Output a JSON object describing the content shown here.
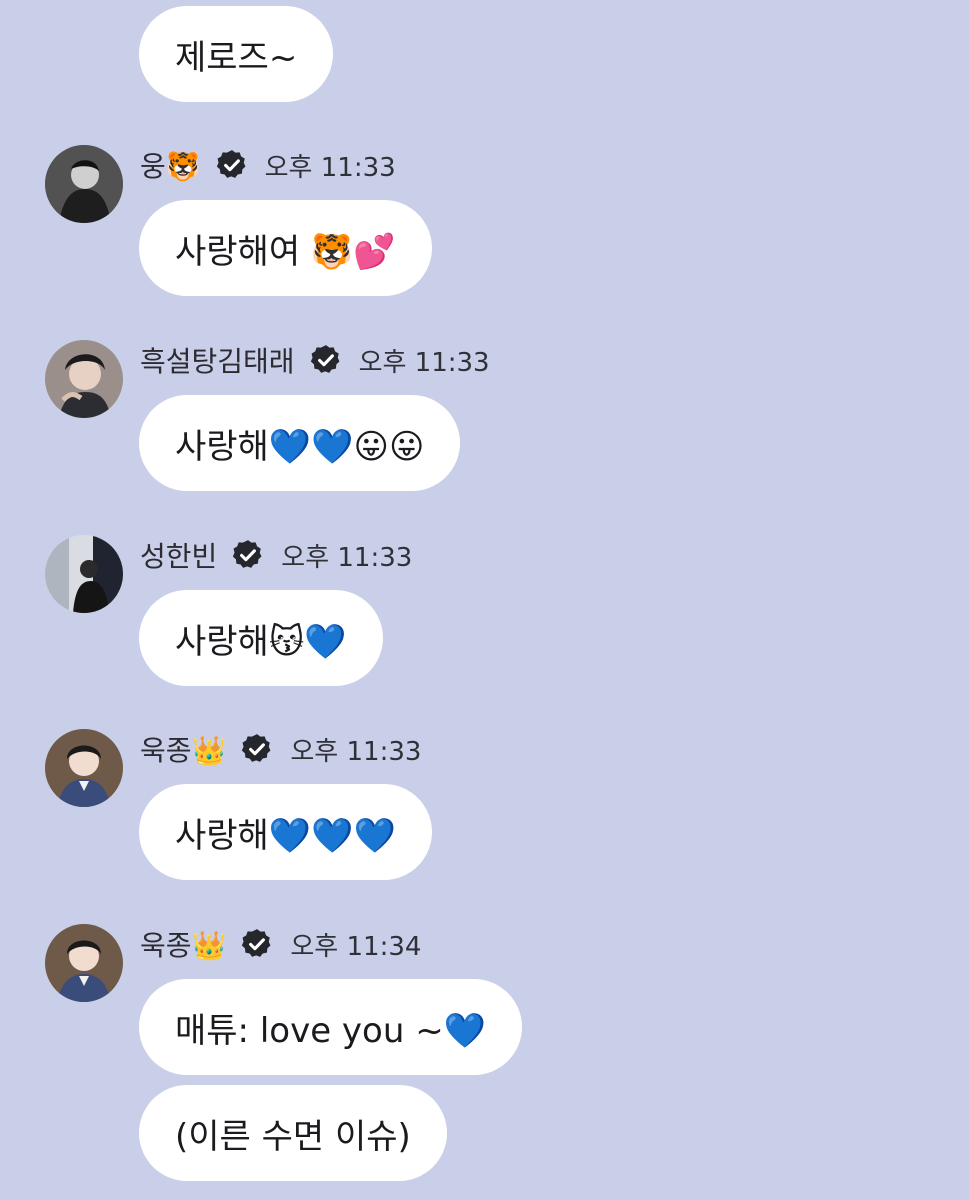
{
  "messages": [
    {
      "sender": "",
      "time": "",
      "text": "제로즈~"
    },
    {
      "sender": "웅🐯",
      "time": "오후 11:33",
      "text": "사랑해여 🐯💕"
    },
    {
      "sender": "흑설탕김태래",
      "time": "오후 11:33",
      "text": "사랑해💙💙😛😛"
    },
    {
      "sender": "성한빈",
      "time": "오후 11:33",
      "text": "사랑해😽💙"
    },
    {
      "sender": "욱종👑",
      "time": "오후 11:33",
      "text": "사랑해💙💙💙"
    },
    {
      "sender": "욱종👑",
      "time": "오후 11:34",
      "text": "매튜: love you ~💙"
    },
    {
      "sender": "욱종👑",
      "time": "오후 11:34",
      "text": "(이른 수면 이슈)"
    }
  ],
  "icons": {
    "verified": "verified-badge-icon",
    "avatar": "profile-avatar"
  },
  "colors": {
    "background": "#c9cfe8",
    "bubble": "#ffffff",
    "heart": "#2f6fe4"
  }
}
